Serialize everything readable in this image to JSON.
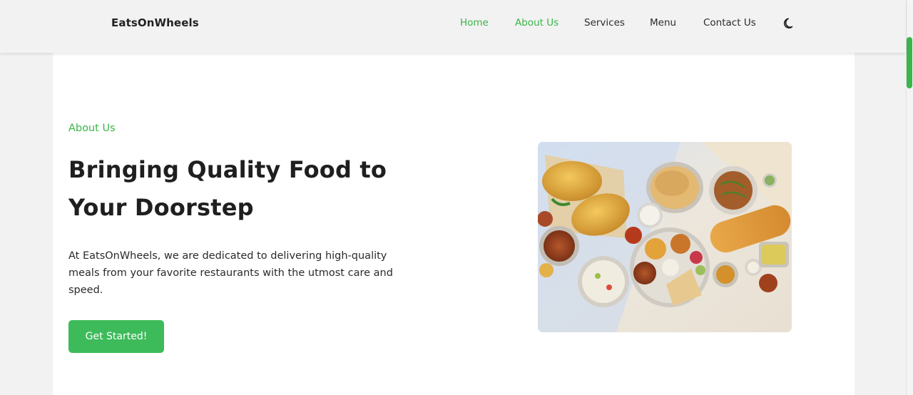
{
  "header": {
    "brand": "EatsOnWheels",
    "nav": [
      {
        "label": "Home"
      },
      {
        "label": "About Us"
      },
      {
        "label": "Services"
      },
      {
        "label": "Menu"
      },
      {
        "label": "Contact Us"
      }
    ],
    "theme_icon": "moon-icon"
  },
  "about": {
    "section_label": "About Us",
    "headline_line1": "Bringing Quality Food to",
    "headline_line2": "Your Doorstep",
    "description": "At EatsOnWheels, we are dedicated to delivering high-quality meals from your favorite restaurants with the utmost care and speed.",
    "cta_label": "Get Started!"
  },
  "colors": {
    "accent": "#3ab54a",
    "background": "#f2f2f2",
    "card": "#ffffff"
  }
}
